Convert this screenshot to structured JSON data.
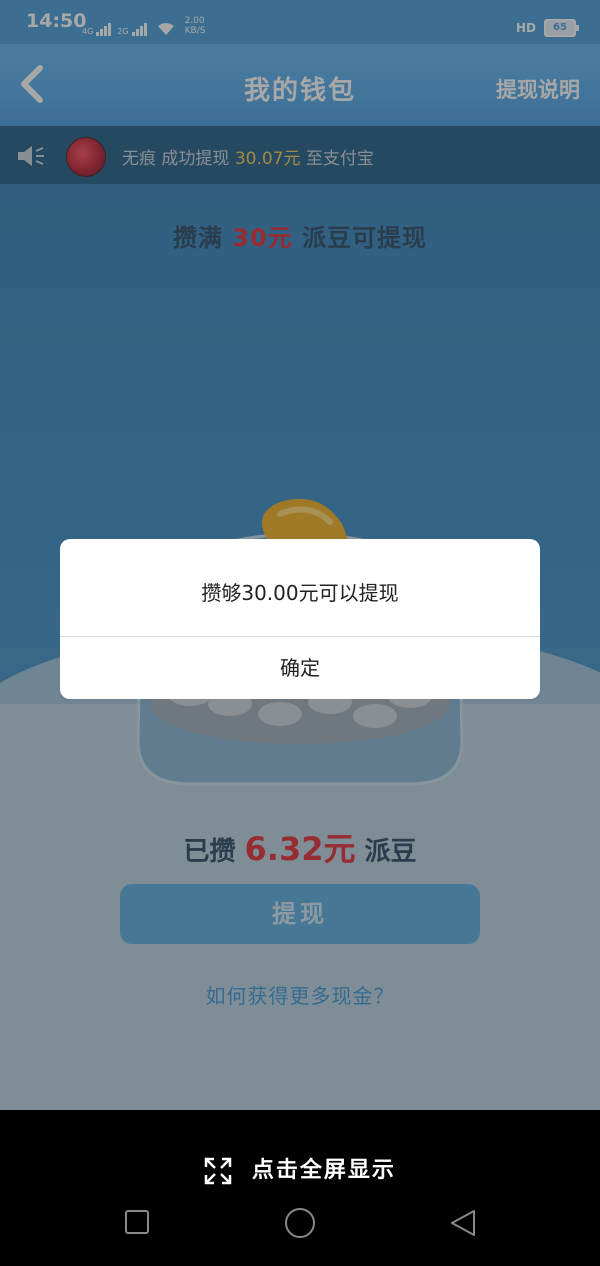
{
  "status_bar": {
    "time": "14:50",
    "net1": "4G",
    "net2": "2G",
    "speed_value": "2.00",
    "speed_unit": "KB/S",
    "hd": "HD",
    "battery": "65"
  },
  "nav": {
    "title": "我的钱包",
    "right_label": "提现说明"
  },
  "notice": {
    "user": "无痕",
    "text_before": "成功提现",
    "amount": "30.07元",
    "text_after": "至支付宝"
  },
  "wallet": {
    "goal_prefix": "攒满",
    "goal_amount": "30元",
    "goal_suffix": "派豆可提现",
    "collected_prefix": "已攒",
    "collected_amount": "6.32元",
    "collected_suffix": "派豆",
    "withdraw_button": "提现",
    "how_link": "如何获得更多现金？"
  },
  "dialog": {
    "message": "攒够30.00元可以提现",
    "confirm": "确定"
  },
  "bottom": {
    "fullscreen": "点击全屏显示"
  }
}
